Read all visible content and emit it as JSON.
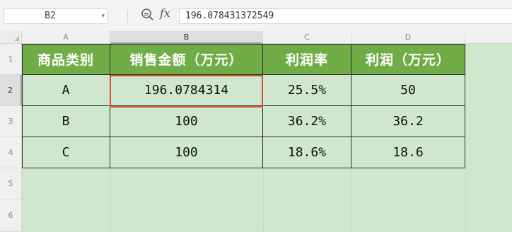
{
  "formula_bar": {
    "name_box": "B2",
    "zoom_icon": "magnifier-zoom-icon",
    "fx_label": "fx",
    "formula_value": "196.078431372549"
  },
  "columns": [
    "A",
    "B",
    "C",
    "D"
  ],
  "rows": [
    "1",
    "2",
    "3",
    "4",
    "5",
    "6"
  ],
  "selected_cell": "B2",
  "table": {
    "headers": [
      "商品类别",
      "销售金额（万元）",
      "利润率",
      "利润（万元）"
    ],
    "data": [
      [
        "A",
        "196.0784314",
        "25.5%",
        "50"
      ],
      [
        "B",
        "100",
        "36.2%",
        "36.2"
      ],
      [
        "C",
        "100",
        "18.6%",
        "18.6"
      ]
    ]
  },
  "colors": {
    "header_fill": "#70ad47",
    "cell_fill": "#cfe7cc",
    "active_border": "#d9532f"
  }
}
